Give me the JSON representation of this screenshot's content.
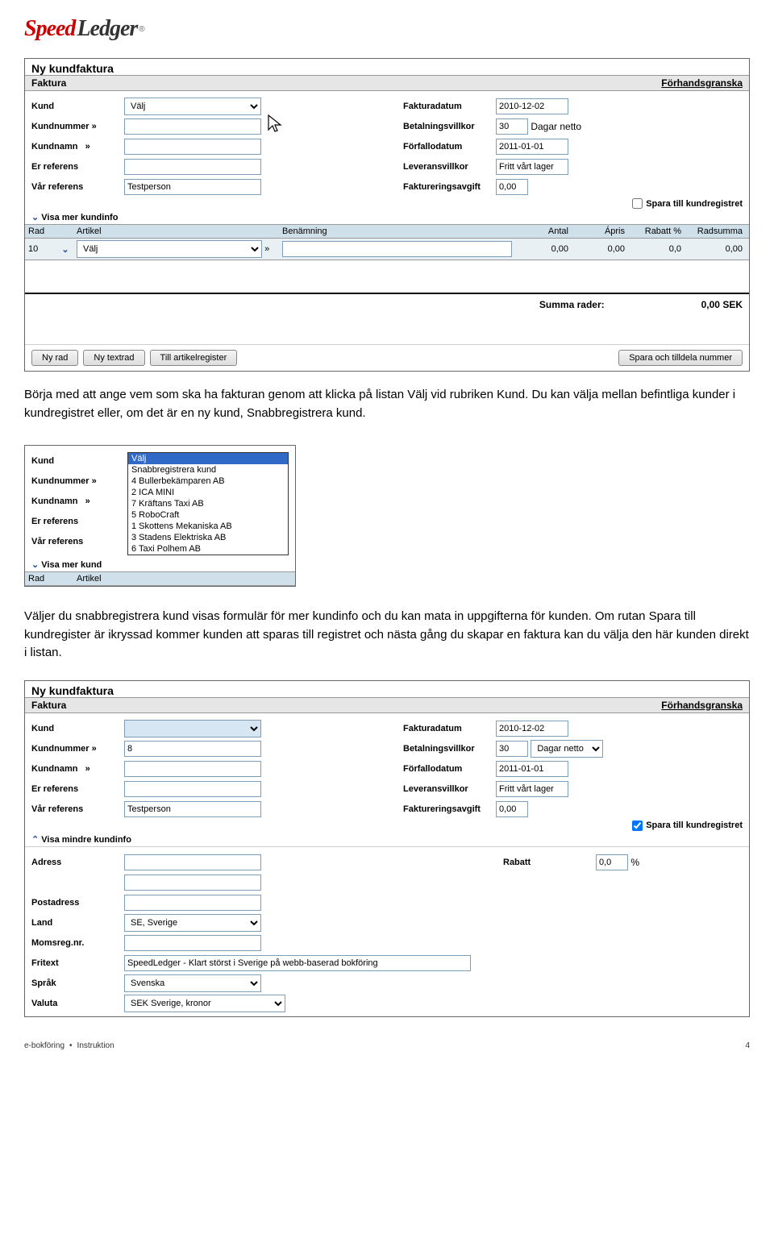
{
  "logo": {
    "speed": "Speed",
    "ledger": "Ledger",
    "tm": "®"
  },
  "panel1": {
    "title": "Ny kundfaktura",
    "tab": "Faktura",
    "preview": "Förhandsgranska",
    "left": {
      "kund": "Kund",
      "kundVal": "Välj",
      "kundnr": "Kundnummer",
      "chev": "»",
      "kundnamn": "Kundnamn",
      "erRef": "Er referens",
      "varRef": "Vår referens",
      "varRefVal": "Testperson"
    },
    "right": {
      "fakturadatum": "Fakturadatum",
      "fakturadatumVal": "2010-12-02",
      "villkor": "Betalningsvillkor",
      "villkorVal": "30",
      "villkorUnit": "Dagar netto",
      "forfall": "Förfallodatum",
      "forfallVal": "2011-01-01",
      "leverans": "Leveransvillkor",
      "leveransVal": "Fritt vårt lager",
      "avgift": "Faktureringsavgift",
      "avgiftVal": "0,00",
      "spara": "Spara till kundregistret"
    },
    "expand": "Visa mer kundinfo",
    "table": {
      "h": {
        "rad": "Rad",
        "art": "Artikel",
        "ben": "Benämning",
        "antal": "Antal",
        "apris": "Ápris",
        "rabatt": "Rabatt %",
        "sum": "Radsumma"
      },
      "r1": {
        "rad": "10",
        "art": "Välj",
        "antal": "0,00",
        "apris": "0,00",
        "rabatt": "0,0",
        "sum": "0,00"
      }
    },
    "summa": {
      "label": "Summa rader:",
      "val": "0,00 SEK"
    },
    "btns": {
      "ny": "Ny rad",
      "text": "Ny textrad",
      "till": "Till artikelregister",
      "spara": "Spara och tilldela nummer"
    }
  },
  "text1": "Börja med att ange vem som ska ha fakturan genom att klicka på listan Välj vid rubriken Kund. Du kan välja mellan befintliga kunder i kundregistret eller, om det är en ny kund, Snabbregistrera kund.",
  "dd": {
    "left": {
      "kund": "Kund",
      "kundnr": "Kundnummer",
      "chev": "»",
      "kundnamn": "Kundnamn",
      "erRef": "Er referens",
      "varRef": "Vår referens"
    },
    "expand": "Visa mer kund",
    "hdr": {
      "rad": "Rad",
      "art": "Artikel"
    },
    "items": [
      "Välj",
      "Snabbregistrera kund",
      "4 Bullerbekämparen AB",
      "2 ICA MINI",
      "7 Kräftans Taxi AB",
      "5 RoboCraft",
      "1 Skottens Mekaniska AB",
      "3 Stadens Elektriska AB",
      "6 Taxi Polhem AB"
    ]
  },
  "text2": "Väljer du snabbregistrera kund visas formulär för mer kundinfo och du kan mata in uppgifterna för kunden. Om rutan Spara till kundregister är ikryssad kommer kunden att sparas till registret och nästa gång du skapar en faktura kan du välja den här kunden direkt i listan.",
  "panel3": {
    "title": "Ny kundfaktura",
    "tab": "Faktura",
    "preview": "Förhandsgranska",
    "left": {
      "kund": "Kund",
      "kundnr": "Kundnummer",
      "kundnrVal": "8",
      "chev": "»",
      "kundnamn": "Kundnamn",
      "erRef": "Er referens",
      "varRef": "Vår referens",
      "varRefVal": "Testperson"
    },
    "right": {
      "fakturadatum": "Fakturadatum",
      "fakturadatumVal": "2010-12-02",
      "villkor": "Betalningsvillkor",
      "villkorVal": "30",
      "villkorUnit": "Dagar netto",
      "forfall": "Förfallodatum",
      "forfallVal": "2011-01-01",
      "leverans": "Leveransvillkor",
      "leveransVal": "Fritt vårt lager",
      "avgift": "Faktureringsavgift",
      "avgiftVal": "0,00",
      "spara": "Spara till kundregistret"
    },
    "expand": "Visa mindre kundinfo",
    "extra": {
      "adress": "Adress",
      "rabatt": "Rabatt",
      "rabattVal": "0,0",
      "pct": "%",
      "postadress": "Postadress",
      "land": "Land",
      "landVal": "SE, Sverige",
      "moms": "Momsreg.nr.",
      "fritext": "Fritext",
      "fritextVal": "SpeedLedger - Klart störst i Sverige på webb-baserad bokföring",
      "sprak": "Språk",
      "sprakVal": "Svenska",
      "valuta": "Valuta",
      "valutaVal": "SEK Sverige, kronor"
    }
  },
  "footer": {
    "left1": "e-bokföring",
    "left2": "Instruktion",
    "page": "4"
  }
}
